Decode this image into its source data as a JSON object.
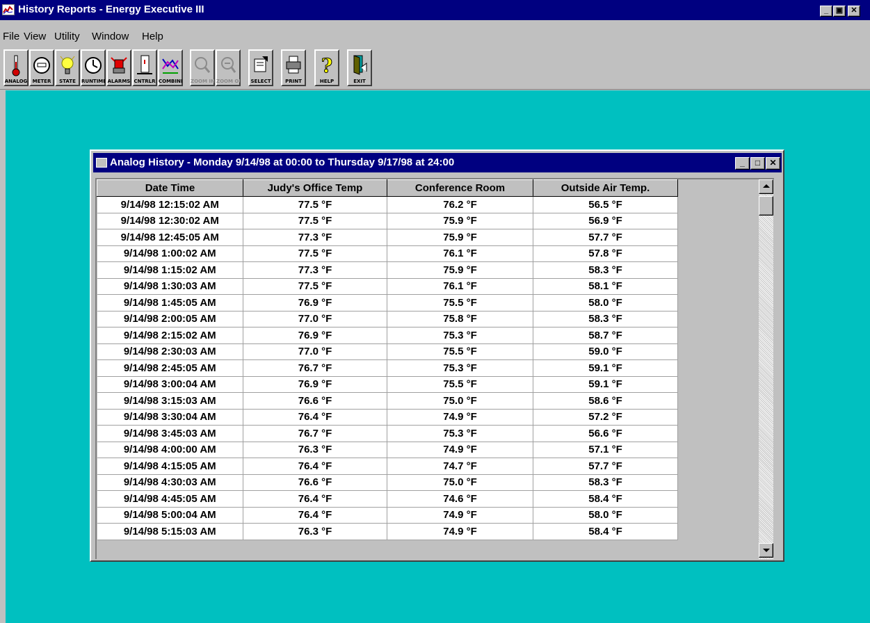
{
  "window": {
    "title": "History Reports - Energy Executive III",
    "controls": {
      "minimize": "_",
      "restore": "▣",
      "close": "✕"
    }
  },
  "menu": [
    "File",
    "View",
    "Utility",
    "Window",
    "Help"
  ],
  "toolbar": [
    {
      "label": "ANALOG",
      "icon": "thermometer-icon",
      "enabled": true
    },
    {
      "label": "METER",
      "icon": "meter-icon",
      "enabled": true
    },
    {
      "label": "STATE",
      "icon": "light-bulb-icon",
      "enabled": true
    },
    {
      "label": "RUNTIME",
      "icon": "clock-icon",
      "enabled": true
    },
    {
      "label": "ALARMS",
      "icon": "alarm-light-icon",
      "enabled": true
    },
    {
      "label": "CNTRLR",
      "icon": "controller-icon",
      "enabled": true
    },
    {
      "label": "COMBINE",
      "icon": "combine-graph-icon",
      "enabled": true
    },
    {
      "label": "ZOOM IN",
      "icon": "zoom-in-icon",
      "enabled": false
    },
    {
      "label": "ZOOM OUT",
      "icon": "zoom-out-icon",
      "enabled": false
    },
    {
      "label": "SELECT",
      "icon": "select-icon",
      "enabled": true
    },
    {
      "label": "PRINT",
      "icon": "printer-icon",
      "enabled": true
    },
    {
      "label": "HELP",
      "icon": "help-question-icon",
      "enabled": true
    },
    {
      "label": "EXIT",
      "icon": "exit-door-icon",
      "enabled": true
    }
  ],
  "child_window": {
    "title": "Analog History - Monday 9/14/98 at 00:00 to Thursday 9/17/98 at 24:00",
    "controls": {
      "minimize": "_",
      "maximize": "□",
      "close": "✕"
    },
    "columns": [
      "Date Time",
      "Judy's Office Temp",
      "Conference Room",
      "Outside Air Temp."
    ],
    "rows": [
      [
        "9/14/98 12:15:02 AM",
        "77.5 °F",
        "76.2 °F",
        "56.5 °F"
      ],
      [
        "9/14/98 12:30:02 AM",
        "77.5 °F",
        "75.9 °F",
        "56.9 °F"
      ],
      [
        "9/14/98 12:45:05 AM",
        "77.3 °F",
        "75.9 °F",
        "57.7 °F"
      ],
      [
        "9/14/98 1:00:02 AM",
        "77.5 °F",
        "76.1 °F",
        "57.8 °F"
      ],
      [
        "9/14/98 1:15:02 AM",
        "77.3 °F",
        "75.9 °F",
        "58.3 °F"
      ],
      [
        "9/14/98 1:30:03 AM",
        "77.5 °F",
        "76.1 °F",
        "58.1 °F"
      ],
      [
        "9/14/98 1:45:05 AM",
        "76.9 °F",
        "75.5 °F",
        "58.0 °F"
      ],
      [
        "9/14/98 2:00:05 AM",
        "77.0 °F",
        "75.8 °F",
        "58.3 °F"
      ],
      [
        "9/14/98 2:15:02 AM",
        "76.9 °F",
        "75.3 °F",
        "58.7 °F"
      ],
      [
        "9/14/98 2:30:03 AM",
        "77.0 °F",
        "75.5 °F",
        "59.0 °F"
      ],
      [
        "9/14/98 2:45:05 AM",
        "76.7 °F",
        "75.3 °F",
        "59.1 °F"
      ],
      [
        "9/14/98 3:00:04 AM",
        "76.9 °F",
        "75.5 °F",
        "59.1 °F"
      ],
      [
        "9/14/98 3:15:03 AM",
        "76.6 °F",
        "75.0 °F",
        "58.6 °F"
      ],
      [
        "9/14/98 3:30:04 AM",
        "76.4 °F",
        "74.9 °F",
        "57.2 °F"
      ],
      [
        "9/14/98 3:45:03 AM",
        "76.7 °F",
        "75.3 °F",
        "56.6 °F"
      ],
      [
        "9/14/98 4:00:00 AM",
        "76.3 °F",
        "74.9 °F",
        "57.1 °F"
      ],
      [
        "9/14/98 4:15:05 AM",
        "76.4 °F",
        "74.7 °F",
        "57.7 °F"
      ],
      [
        "9/14/98 4:30:03 AM",
        "76.6 °F",
        "75.0 °F",
        "58.3 °F"
      ],
      [
        "9/14/98 4:45:05 AM",
        "76.4 °F",
        "74.6 °F",
        "58.4 °F"
      ],
      [
        "9/14/98 5:00:04 AM",
        "76.4 °F",
        "74.9 °F",
        "58.0 °F"
      ],
      [
        "9/14/98 5:15:03 AM",
        "76.3 °F",
        "74.9 °F",
        "58.4 °F"
      ]
    ]
  },
  "colors": {
    "title_bar": "#000080",
    "desktop": "#00c0c0",
    "face": "#c0c0c0"
  }
}
